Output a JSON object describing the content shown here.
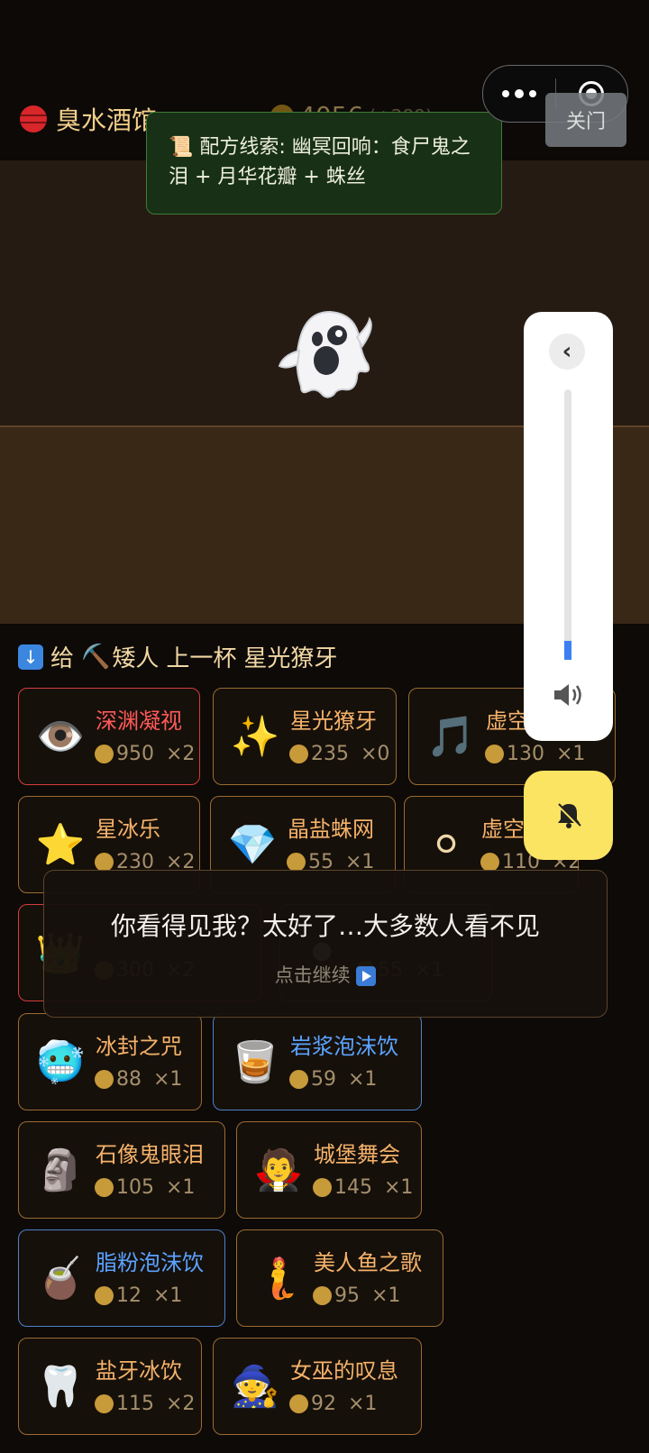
{
  "header": {
    "tavern_name": "臭水酒馆",
    "coins": "4056",
    "coins_delta": "(+289)",
    "close_label": "关门"
  },
  "hint": {
    "icon": "scroll-icon",
    "text": "📜 配方线索: 幽冥回响：食尸鬼之泪 + 月华花瓣 + 蛛丝"
  },
  "scene": {
    "customer_icon": "ghost-icon"
  },
  "order": {
    "icon": "download-icon",
    "prefix": "给",
    "customer_emoji": "⛏️",
    "customer": "矮人",
    "action": "上一杯",
    "drink": "星光獠牙"
  },
  "dialog": {
    "text": "你看得见我？太好了…大多数人看不见",
    "continue": "点击继续"
  },
  "cards": [
    {
      "name": "深渊凝视",
      "emoji": "👁️",
      "price": "950",
      "count": "×2",
      "style": "red"
    },
    {
      "name": "星光獠牙",
      "emoji": "✨",
      "price": "235",
      "count": "×0",
      "style": "normal"
    },
    {
      "name": "虚空",
      "emoji": "🎵",
      "price": "130",
      "count": "×1",
      "style": "normal"
    },
    {
      "name": "星冰乐",
      "emoji": "⭐",
      "price": "230",
      "count": "×2",
      "style": "normal"
    },
    {
      "name": "晶盐蛛网",
      "emoji": "💎",
      "price": "55",
      "count": "×1",
      "style": "normal"
    },
    {
      "name": "虚空",
      "emoji": "⚪",
      "price": "110",
      "count": "×2",
      "style": "normal"
    },
    {
      "name": "",
      "emoji": "👑",
      "price": "300",
      "count": "×2",
      "style": "red"
    },
    {
      "name": "",
      "emoji": "⚫",
      "price": "55",
      "count": "×1",
      "style": "normal"
    },
    {
      "name": "冰封之咒",
      "emoji": "🥶",
      "price": "88",
      "count": "×1",
      "style": "normal"
    },
    {
      "name": "岩浆泡沫饮",
      "emoji": "🥃",
      "price": "59",
      "count": "×1",
      "style": "blue"
    },
    {
      "name": "石像鬼眼泪",
      "emoji": "🗿",
      "price": "105",
      "count": "×1",
      "style": "normal"
    },
    {
      "name": "城堡舞会",
      "emoji": "🧛",
      "price": "145",
      "count": "×1",
      "style": "normal"
    },
    {
      "name": "脂粉泡沫饮",
      "emoji": "🧉",
      "price": "12",
      "count": "×1",
      "style": "blue"
    },
    {
      "name": "美人鱼之歌",
      "emoji": "🧜",
      "price": "95",
      "count": "×1",
      "style": "normal"
    },
    {
      "name": "盐牙冰饮",
      "emoji": "🦷",
      "price": "115",
      "count": "×2",
      "style": "normal"
    },
    {
      "name": "女巫的叹息",
      "emoji": "🧙",
      "price": "92",
      "count": "×1",
      "style": "normal"
    }
  ],
  "volume": {
    "level": 0.07
  }
}
